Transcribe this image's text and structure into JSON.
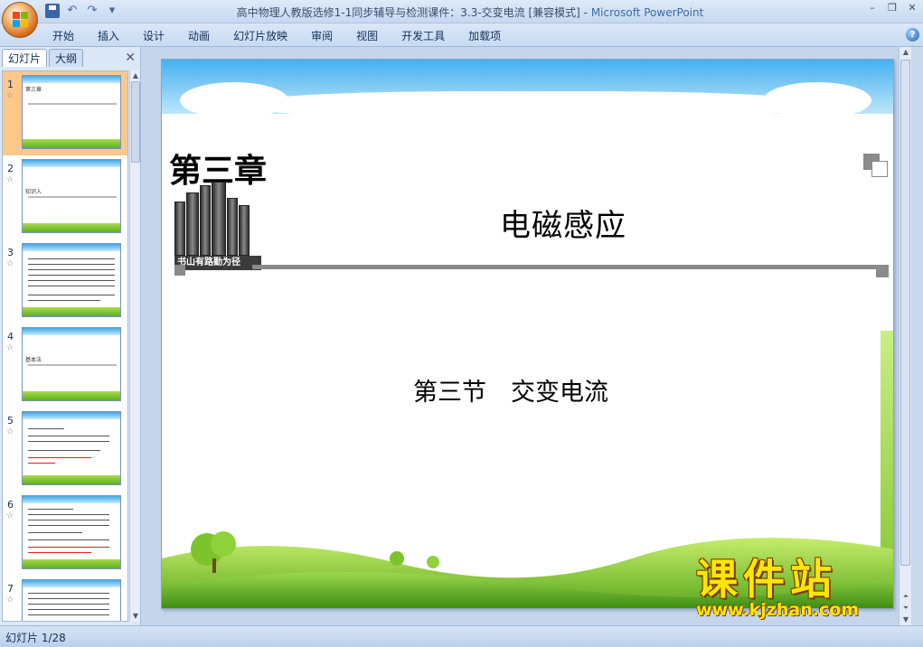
{
  "titlebar": {
    "document_title": "高中物理人教版选修1-1同步辅导与检测课件：3.3-交变电流 [兼容模式]",
    "separator": " - ",
    "app_name": "Microsoft PowerPoint"
  },
  "ribbon": {
    "tabs": [
      "开始",
      "插入",
      "设计",
      "动画",
      "幻灯片放映",
      "审阅",
      "视图",
      "开发工具",
      "加载项"
    ]
  },
  "left_pane": {
    "tab_slides": "幻灯片",
    "tab_outline": "大纲",
    "thumbnails": [
      {
        "num": "1",
        "label": "第三章"
      },
      {
        "num": "2",
        "label": "知识入"
      },
      {
        "num": "3",
        "label": ""
      },
      {
        "num": "4",
        "label": "基本法"
      },
      {
        "num": "5",
        "label": ""
      },
      {
        "num": "6",
        "label": ""
      },
      {
        "num": "7",
        "label": ""
      }
    ],
    "selected_index": 0
  },
  "slide": {
    "chapter": "第三章",
    "motto": "书山有路勤为径",
    "title": "电磁感应",
    "subtitle": "第三节　交变电流"
  },
  "watermark": {
    "cn": "课件站",
    "url": "www.kjzhan.com"
  },
  "statusbar": {
    "slide_info": "幻灯片 1/28"
  },
  "colors": {
    "sky": "#45b0ef",
    "grass": "#7cc42c",
    "thumb_selected": "#fbc88a",
    "watermark": "#ffe600"
  }
}
